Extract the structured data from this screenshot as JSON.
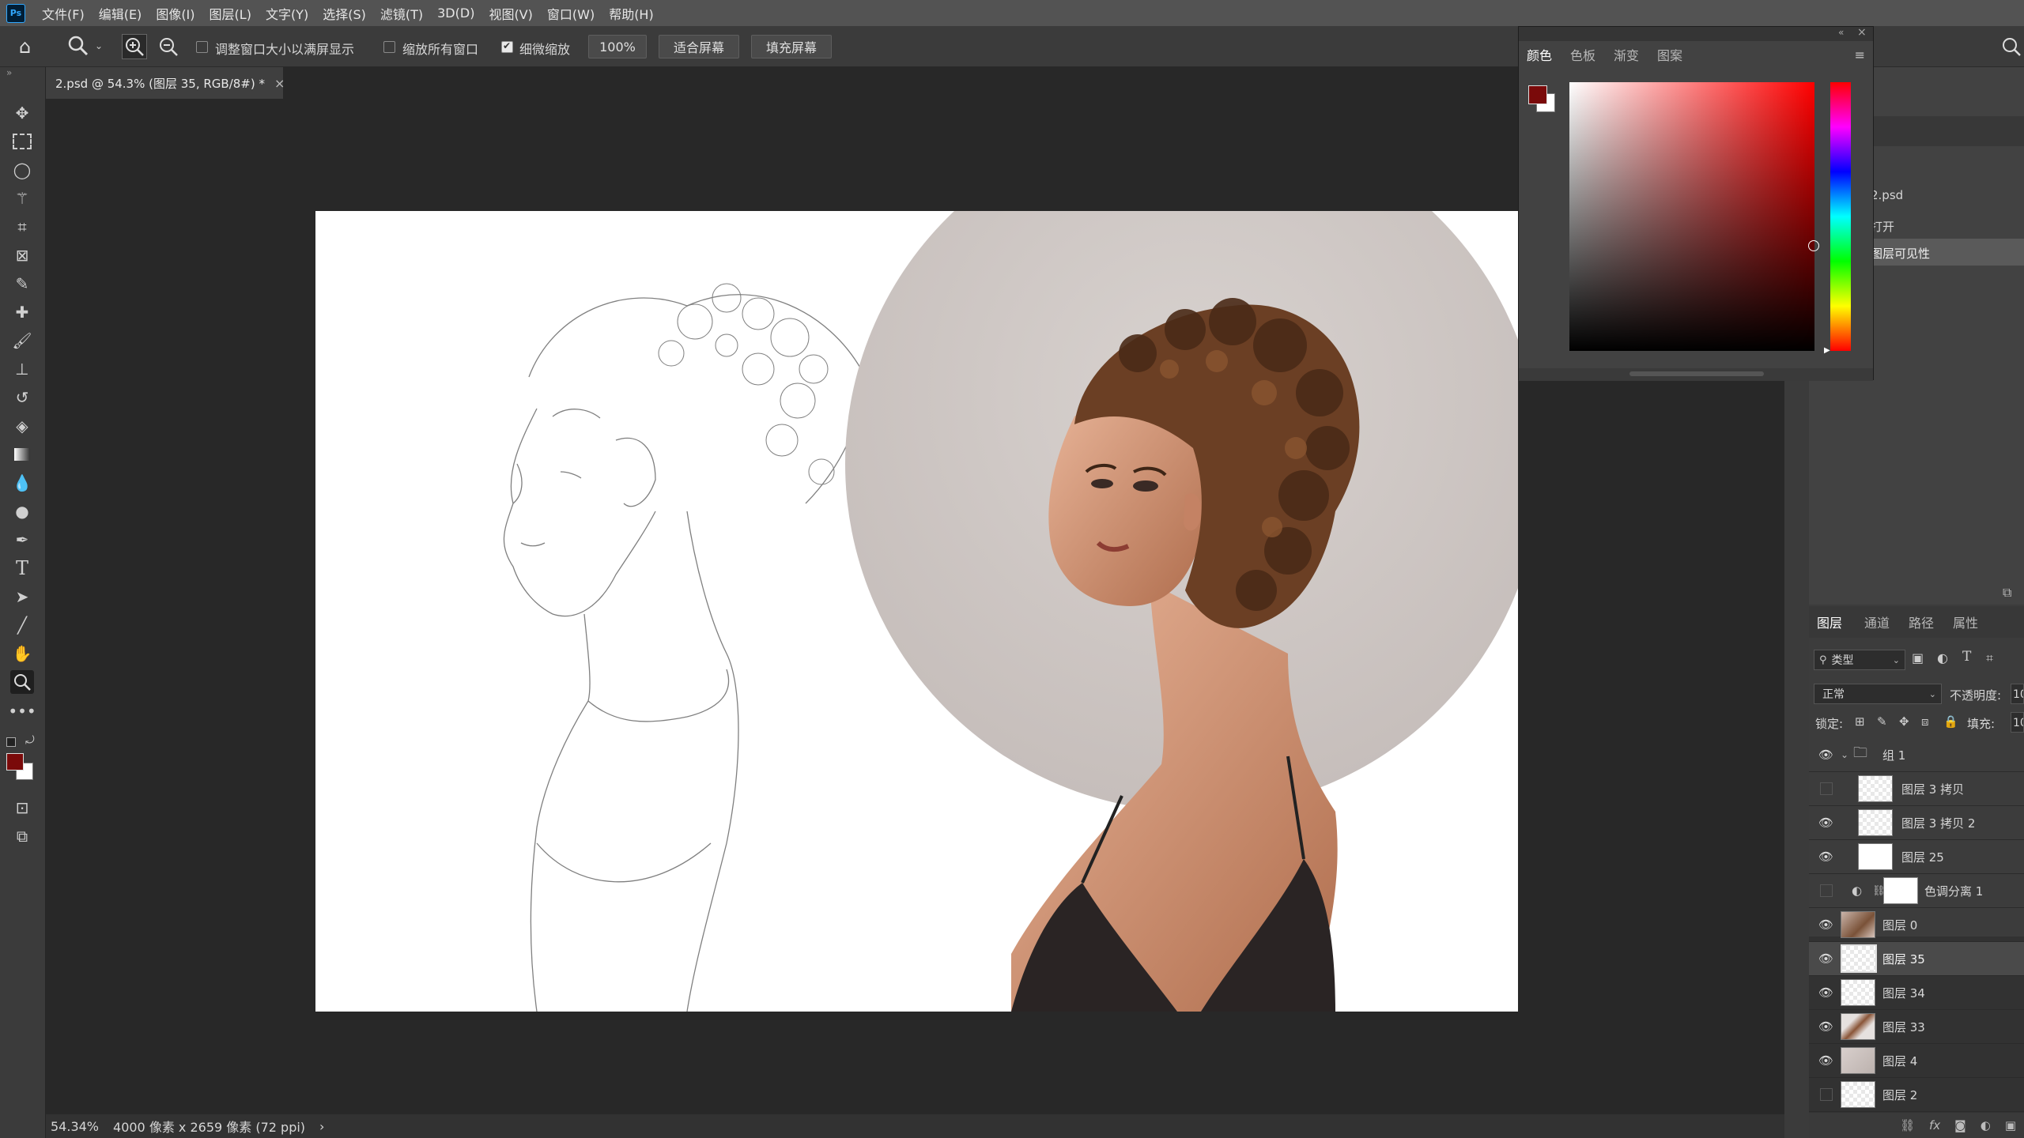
{
  "menu": [
    "文件(F)",
    "编辑(E)",
    "图像(I)",
    "图层(L)",
    "文字(Y)",
    "选择(S)",
    "滤镜(T)",
    "3D(D)",
    "视图(V)",
    "窗口(W)",
    "帮助(H)"
  ],
  "logo": "Ps",
  "options": {
    "cb_resize": "调整窗口大小以满屏显示",
    "cb_zoom_all": "缩放所有窗口",
    "cb_scrubby": "细微缩放",
    "zoom_value": "100%",
    "fit_screen": "适合屏幕",
    "fill_screen": "填充屏幕"
  },
  "document_tab": "2.psd @ 54.3% (图层 35, RGB/8#) *",
  "status": {
    "zoom": "54.34%",
    "size": "4000 像素 x 2659 像素 (72 ppi)"
  },
  "color_panel": {
    "tabs": [
      "颜色",
      "色板",
      "渐变",
      "图案"
    ],
    "foreground": "#7a0a0a",
    "background": "#ffffff",
    "hue_color": "#ff0000"
  },
  "history": {
    "doc": "2.psd",
    "items": [
      "打开",
      "图层可见性"
    ]
  },
  "layers_panel": {
    "tabs": [
      "图层",
      "通道",
      "路径",
      "属性"
    ],
    "filter": "类型",
    "blend_mode": "正常",
    "opacity_label": "不透明度:",
    "opacity_value": "10",
    "lock_label": "锁定:",
    "fill_label": "填充:",
    "fill_value": "10",
    "layers": [
      {
        "name": "组 1",
        "visible": true,
        "kind": "group"
      },
      {
        "name": "图层 3 拷贝",
        "visible": false,
        "kind": "layer"
      },
      {
        "name": "图层 3 拷贝 2",
        "visible": true,
        "kind": "layer"
      },
      {
        "name": "图层 25",
        "visible": true,
        "kind": "layer"
      },
      {
        "name": "色调分离 1",
        "visible": false,
        "kind": "adjustment"
      },
      {
        "name": "图层 0",
        "visible": true,
        "kind": "photo"
      },
      {
        "name": "图层 35",
        "visible": true,
        "kind": "layer",
        "selected": true
      },
      {
        "name": "图层 34",
        "visible": true,
        "kind": "layer"
      },
      {
        "name": "图层 33",
        "visible": true,
        "kind": "photo"
      },
      {
        "name": "图层 4",
        "visible": true,
        "kind": "layer"
      },
      {
        "name": "图层 2",
        "visible": false,
        "kind": "layer"
      }
    ]
  }
}
